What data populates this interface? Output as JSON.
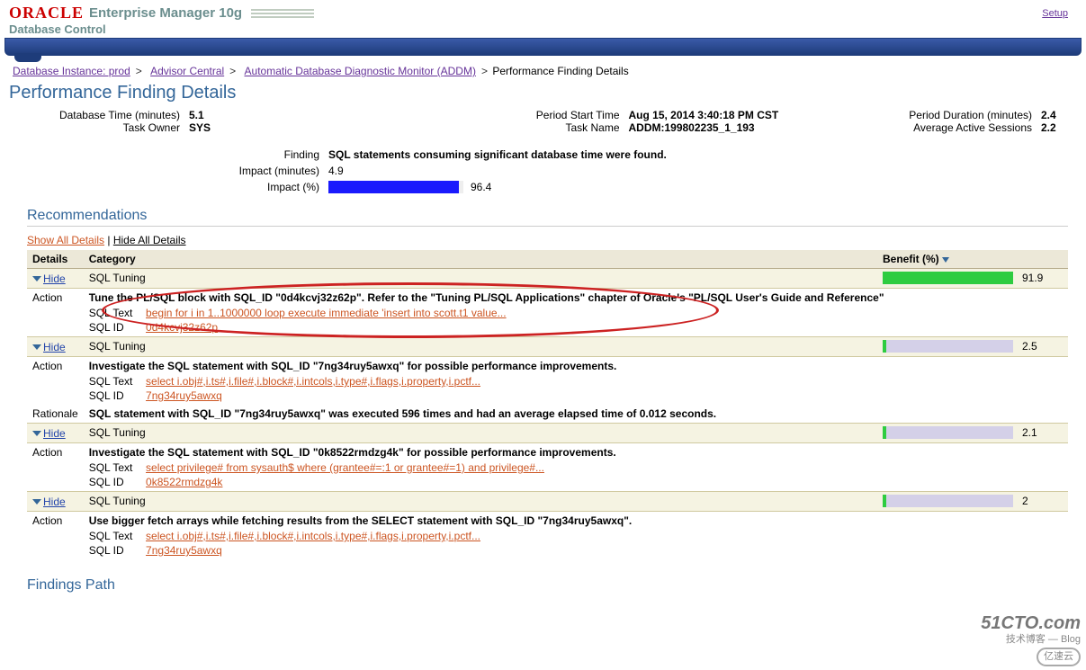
{
  "header": {
    "oracle": "ORACLE",
    "product": "Enterprise Manager 10g",
    "sub": "Database Control",
    "setup": "Setup"
  },
  "breadcrumb": {
    "items": [
      "Database Instance: prod",
      "Advisor Central",
      "Automatic Database Diagnostic Monitor (ADDM)"
    ],
    "current": "Performance Finding Details"
  },
  "page_title": "Performance Finding Details",
  "info": {
    "db_time_lbl": "Database Time (minutes)",
    "db_time_val": "5.1",
    "task_owner_lbl": "Task Owner",
    "task_owner_val": "SYS",
    "period_start_lbl": "Period Start Time",
    "period_start_val": "Aug 15, 2014 3:40:18 PM CST",
    "task_name_lbl": "Task Name",
    "task_name_val": "ADDM:199802235_1_193",
    "period_dur_lbl": "Period Duration (minutes)",
    "period_dur_val": "2.4",
    "avg_sess_lbl": "Average Active Sessions",
    "avg_sess_val": "2.2"
  },
  "finding": {
    "finding_lbl": "Finding",
    "finding_val": "SQL statements consuming significant database time were found.",
    "impact_min_lbl": "Impact (minutes)",
    "impact_min_val": "4.9",
    "impact_pct_lbl": "Impact (%)",
    "impact_pct_val": "96.4"
  },
  "recommendations": {
    "title": "Recommendations",
    "show_all": "Show All Details",
    "hide_all": "Hide All Details",
    "cols": {
      "details": "Details",
      "category": "Category",
      "benefit": "Benefit (%)"
    },
    "hide_label": "Hide",
    "action_label": "Action",
    "rationale_label": "Rationale",
    "sqltext_label": "SQL Text",
    "sqlid_label": "SQL ID",
    "items": [
      {
        "category": "SQL Tuning",
        "benefit_pct": 91.9,
        "bar_full": true,
        "action": "Tune the PL/SQL block with SQL_ID \"0d4kcvj32z62p\". Refer to the \"Tuning PL/SQL Applications\" chapter of Oracle's \"PL/SQL User's Guide and Reference\"",
        "sql_text": "begin for i in 1..1000000 loop execute immediate 'insert into scott.t1 value...",
        "sql_id": "0d4kcvj32z62p",
        "highlight": true
      },
      {
        "category": "SQL Tuning",
        "benefit_pct": 2.5,
        "bar_full": false,
        "action": "Investigate the SQL statement with SQL_ID \"7ng34ruy5awxq\" for possible performance improvements.",
        "sql_text": "select i.obj#,i.ts#,i.file#,i.block#,i.intcols,i.type#,i.flags,i.property,i.pctf...",
        "sql_id": "7ng34ruy5awxq",
        "rationale": "SQL statement with SQL_ID \"7ng34ruy5awxq\" was executed 596 times and had an average elapsed time of 0.012 seconds."
      },
      {
        "category": "SQL Tuning",
        "benefit_pct": 2.1,
        "bar_full": false,
        "action": "Investigate the SQL statement with SQL_ID \"0k8522rmdzg4k\" for possible performance improvements.",
        "sql_text": "select privilege# from sysauth$ where (grantee#=:1 or grantee#=1) and privilege#...",
        "sql_id": "0k8522rmdzg4k"
      },
      {
        "category": "SQL Tuning",
        "benefit_pct": 2,
        "bar_full": false,
        "action": "Use bigger fetch arrays while fetching results from the SELECT statement with SQL_ID \"7ng34ruy5awxq\".",
        "sql_text": "select i.obj#,i.ts#,i.file#,i.block#,i.intcols,i.type#,i.flags,i.property,i.pctf...",
        "sql_id": "7ng34ruy5awxq"
      }
    ]
  },
  "findings_path_title": "Findings Path",
  "watermark": {
    "l1": "51CTO.com",
    "l2": "技术博客 — Blog",
    "l3": "亿速云"
  }
}
